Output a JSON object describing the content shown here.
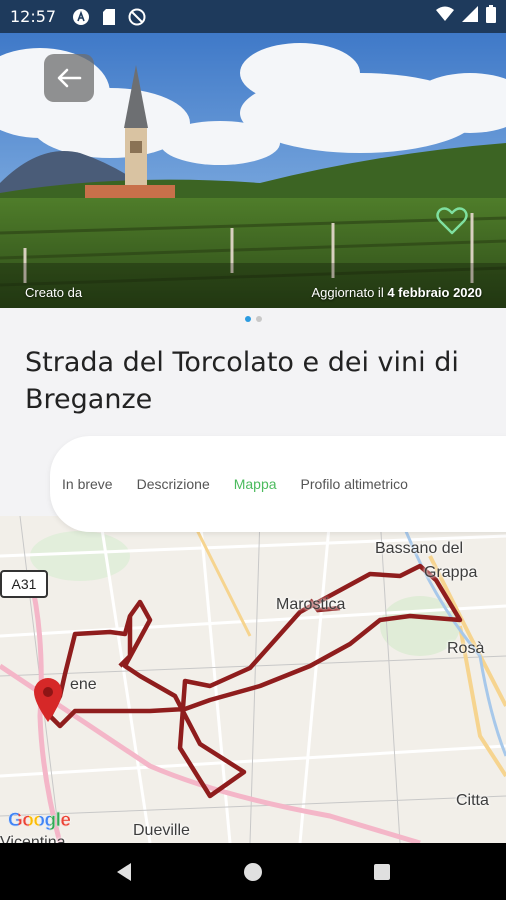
{
  "status_bar": {
    "time": "12:57",
    "left_icons": [
      "accessibility-icon",
      "sd-card-icon",
      "no-data-icon"
    ],
    "right_icons": [
      "wifi-icon",
      "signal-icon",
      "battery-icon"
    ]
  },
  "hero": {
    "created_by_label": "Creato da",
    "updated_prefix": "Aggiornato il",
    "updated_date": "4 febbraio 2020",
    "back_icon": "arrow-left-icon",
    "favorite_icon": "heart-outline-icon"
  },
  "pager": {
    "count": 2,
    "active": 0
  },
  "route": {
    "title": "Strada del Torcolato e dei vini di Breganze"
  },
  "tabs": [
    {
      "label": "In breve",
      "active": false
    },
    {
      "label": "Descrizione",
      "active": false
    },
    {
      "label": "Mappa",
      "active": true
    },
    {
      "label": "Profilo altimetrico",
      "active": false
    }
  ],
  "map": {
    "road_badge": "A31",
    "places": {
      "bassano_line1": "Bassano del",
      "bassano_line2": "Grappa",
      "marostica": "Marostica",
      "rosa": "Rosà",
      "thiene": "ene",
      "cittadella": "Citta",
      "dueville": "Dueville",
      "vicentina": "Vicentina"
    },
    "attribution": "Google",
    "route_color": "#9a1f1f",
    "pin_color": "#d62828"
  },
  "colors": {
    "accent": "#4cbb5e",
    "status_bar": "#1e3a5c",
    "pager_active": "#2b9be0"
  },
  "nav_bar": {
    "back": "back-triangle-icon",
    "home": "home-circle-icon",
    "recents": "recents-square-icon"
  }
}
